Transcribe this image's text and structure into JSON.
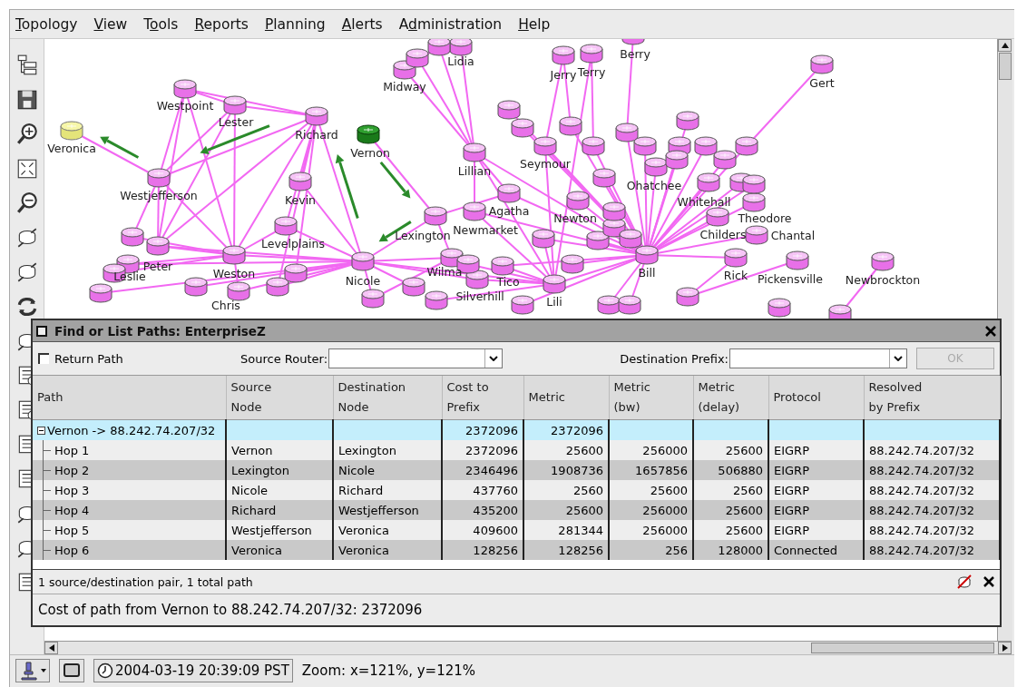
{
  "menu": [
    "Topology",
    "View",
    "Tools",
    "Reports",
    "Planning",
    "Alerts",
    "Administration",
    "Help"
  ],
  "topology": {
    "nodes": [
      {
        "name": "Veronica",
        "kind": "destination"
      },
      {
        "name": "Vernon",
        "kind": "source"
      },
      {
        "name": "Westpoint",
        "kind": "router"
      },
      {
        "name": "Lester",
        "kind": "router"
      },
      {
        "name": "Richard",
        "kind": "router"
      },
      {
        "name": "Westjefferson",
        "kind": "router"
      },
      {
        "name": "Kevin",
        "kind": "router"
      },
      {
        "name": "Levelplains",
        "kind": "router"
      },
      {
        "name": "Weston",
        "kind": "router"
      },
      {
        "name": "Nicole",
        "kind": "router"
      },
      {
        "name": "Lexington",
        "kind": "router"
      },
      {
        "name": "Peter",
        "kind": "router"
      },
      {
        "name": "Lillian",
        "kind": "router"
      },
      {
        "name": "Midway",
        "kind": "router"
      },
      {
        "name": "Lidia",
        "kind": "router"
      },
      {
        "name": "Jerry",
        "kind": "router"
      },
      {
        "name": "Terry",
        "kind": "router"
      },
      {
        "name": "Berry",
        "kind": "router"
      },
      {
        "name": "Gert",
        "kind": "router"
      },
      {
        "name": "Agatha",
        "kind": "router"
      },
      {
        "name": "Newmarket",
        "kind": "router"
      },
      {
        "name": "Bill",
        "kind": "router"
      },
      {
        "name": "Rick",
        "kind": "router"
      },
      {
        "name": "Chantal",
        "kind": "router"
      },
      {
        "name": "Pickensville",
        "kind": "router"
      },
      {
        "name": "Newbrockton",
        "kind": "router"
      },
      {
        "name": "Wilma",
        "kind": "router"
      },
      {
        "name": "Tico",
        "kind": "router"
      },
      {
        "name": "Silverhill",
        "kind": "router"
      },
      {
        "name": "Seymour",
        "kind": "router"
      },
      {
        "name": "Newton",
        "kind": "router"
      },
      {
        "name": "Ohatchee",
        "kind": "router"
      },
      {
        "name": "Childers",
        "kind": "router"
      },
      {
        "name": "Theodore",
        "kind": "router"
      },
      {
        "name": "Whitehall",
        "kind": "router"
      },
      {
        "name": "Chris",
        "kind": "router"
      },
      {
        "name": "Leslie",
        "kind": "router"
      },
      {
        "name": "Lili",
        "kind": "router"
      },
      {
        "kind": "router"
      },
      {
        "kind": "router"
      },
      {
        "kind": "router"
      },
      {
        "kind": "router"
      },
      {
        "kind": "router"
      },
      {
        "kind": "router"
      },
      {
        "kind": "router"
      },
      {
        "kind": "router"
      },
      {
        "kind": "router"
      },
      {
        "kind": "router"
      },
      {
        "kind": "router"
      },
      {
        "kind": "router"
      },
      {
        "kind": "router"
      },
      {
        "kind": "router"
      },
      {
        "kind": "router"
      },
      {
        "kind": "router"
      },
      {
        "kind": "router"
      },
      {
        "kind": "router"
      },
      {
        "kind": "router"
      },
      {
        "kind": "router"
      },
      {
        "kind": "router"
      },
      {
        "kind": "router"
      },
      {
        "kind": "router"
      },
      {
        "kind": "router"
      },
      {
        "kind": "router"
      },
      {
        "kind": "router"
      },
      {
        "kind": "router"
      },
      {
        "kind": "router"
      },
      {
        "kind": "router"
      },
      {
        "kind": "router"
      },
      {
        "kind": "router"
      },
      {
        "kind": "router"
      },
      {
        "kind": "router"
      },
      {
        "kind": "router"
      },
      {
        "kind": "router"
      },
      {
        "kind": "router"
      },
      {
        "kind": "router"
      },
      {
        "kind": "router"
      },
      {
        "kind": "router"
      }
    ]
  },
  "dialog": {
    "title": "Find or List Paths: EnterpriseZ",
    "return_path": {
      "label": "Return Path",
      "checked": false
    },
    "source_router": {
      "label": "Source Router:"
    },
    "destination_prefix": {
      "label": "Destination Prefix:"
    },
    "ok_button": {
      "label": "OK",
      "disabled": true
    },
    "table": {
      "columns": [
        "Path",
        "Source\nNode",
        "Destination\nNode",
        "Cost to\nPrefix",
        "Metric",
        "Metric\n(bw)",
        "Metric\n(delay)",
        "Protocol",
        "Resolved\nby Prefix"
      ],
      "rows": [
        {
          "path": "Vernon -> 88.242.74.207/32",
          "cost": "2372096",
          "metric": "2372096",
          "expanded": true,
          "selected": true,
          "children": [
            {
              "path": "Hop 1",
              "source": "Vernon",
              "destination": "Lexington",
              "cost": "2372096",
              "metric": "25600",
              "bw": "256000",
              "delay": "25600",
              "protocol": "EIGRP",
              "resolved": "88.242.74.207/32",
              "selected": false
            },
            {
              "path": "Hop 2",
              "source": "Lexington",
              "destination": "Nicole",
              "cost": "2346496",
              "metric": "1908736",
              "bw": "1657856",
              "delay": "506880",
              "protocol": "EIGRP",
              "resolved": "88.242.74.207/32",
              "selected": false
            },
            {
              "path": "Hop 3",
              "source": "Nicole",
              "destination": "Richard",
              "cost": "437760",
              "metric": "2560",
              "bw": "25600",
              "delay": "2560",
              "protocol": "EIGRP",
              "resolved": "88.242.74.207/32",
              "selected": false
            },
            {
              "path": "Hop 4",
              "source": "Richard",
              "destination": "Westjefferson",
              "cost": "435200",
              "metric": "25600",
              "bw": "256000",
              "delay": "25600",
              "protocol": "EIGRP",
              "resolved": "88.242.74.207/32",
              "selected": false
            },
            {
              "path": "Hop 5",
              "source": "Westjefferson",
              "destination": "Veronica",
              "cost": "409600",
              "metric": "281344",
              "bw": "256000",
              "delay": "25600",
              "protocol": "EIGRP",
              "resolved": "88.242.74.207/32",
              "selected": false
            },
            {
              "path": "Hop 6",
              "source": "Veronica",
              "destination": "Veronica",
              "cost": "128256",
              "metric": "128256",
              "bw": "256",
              "delay": "128000",
              "protocol": "Connected",
              "resolved": "88.242.74.207/32",
              "selected": false
            }
          ]
        }
      ]
    },
    "summary": "1 source/destination pair, 1 total path",
    "cost_line": "Cost of path from Vernon to 88.242.74.207/32: 2372096"
  },
  "status_bar": {
    "timestamp": "2004-03-19 20:39:09 PST",
    "zoom": "Zoom: x=121%, y=121%"
  }
}
